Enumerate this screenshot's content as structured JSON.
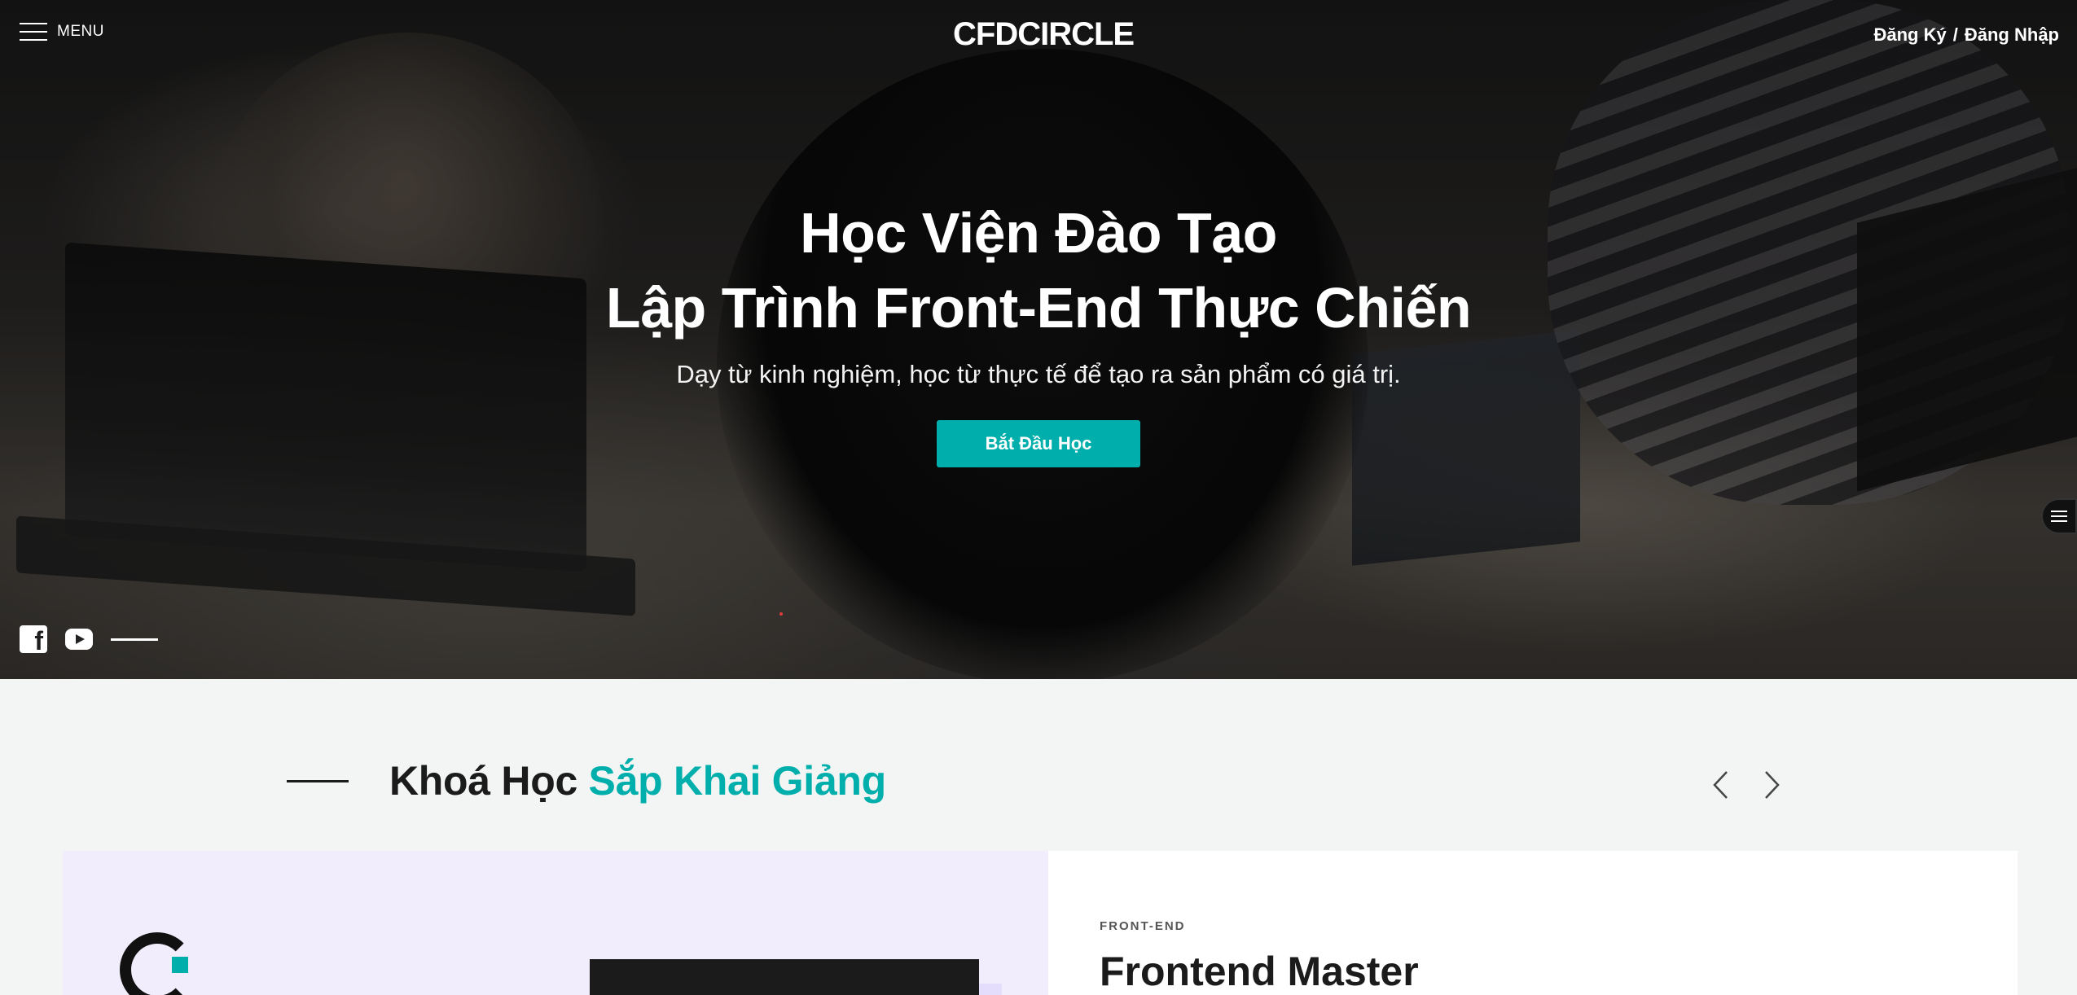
{
  "topbar": {
    "menu_label": "MENU",
    "logo": "CFDCIRCLE",
    "register": "Đăng Ký",
    "separator": "/",
    "login": "Đăng Nhập"
  },
  "hero": {
    "title_line1": "Học Viện Đào Tạo",
    "title_line2": "Lập Trình Front-End Thực Chiến",
    "subtitle": "Dạy từ kinh nghiệm, học từ thực tế để tạo ra sản phẩm có giá trị.",
    "cta_label": "Bắt Đầu Học"
  },
  "social": {
    "icons": [
      "facebook-icon",
      "youtube-icon"
    ]
  },
  "courses": {
    "title_part1": "Khoá Học",
    "title_part2": "Sắp Khai Giảng",
    "card": {
      "category": "FRONT-END",
      "title": "Frontend Master"
    }
  },
  "colors": {
    "accent": "#00afab",
    "dark": "#1b1b1b",
    "section_bg": "#f3f5f4",
    "card_media_bg": "#f1edfd"
  }
}
